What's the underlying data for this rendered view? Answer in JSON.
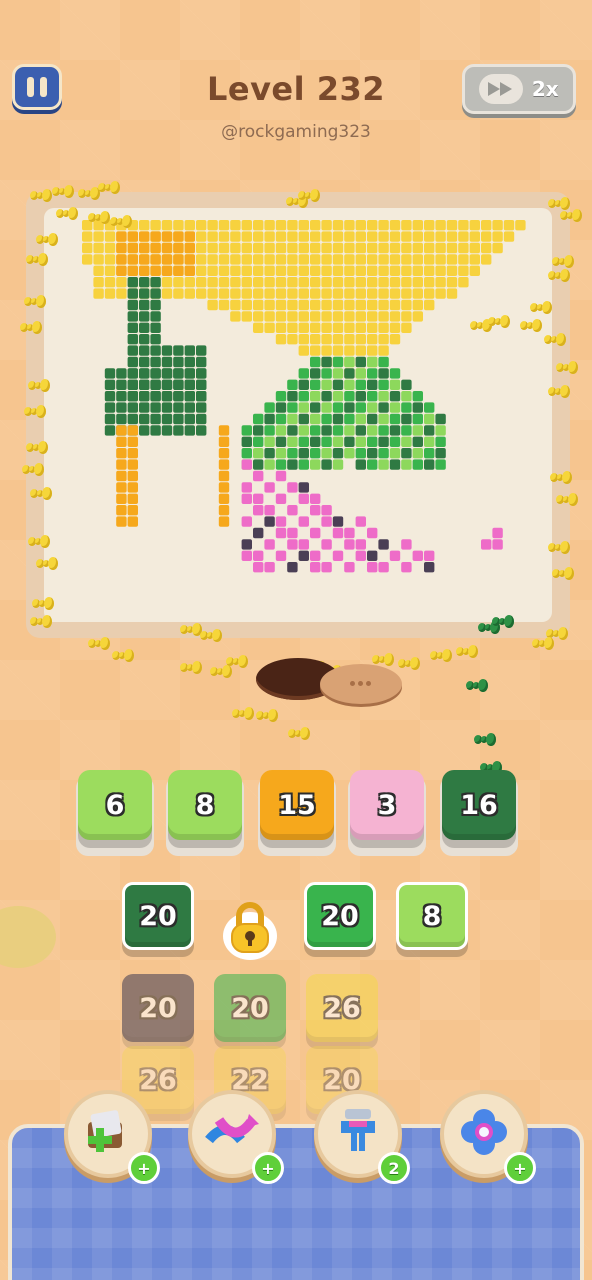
{
  "header": {
    "title": "Level 232",
    "subtitle": "@rockgaming323",
    "speed_label": "2x"
  },
  "queue": [
    {
      "value": "6",
      "color": "#9cdc5e"
    },
    {
      "value": "8",
      "color": "#9cdc5e"
    },
    {
      "value": "15",
      "color": "#f6a81c"
    },
    {
      "value": "3",
      "color": "#f5b3d2"
    },
    {
      "value": "16",
      "color": "#2f7a43"
    }
  ],
  "grid": {
    "row1": [
      {
        "value": "20",
        "color": "#2f7a43"
      },
      {
        "value": "20",
        "color": "#39b44d"
      },
      {
        "value": "8",
        "color": "#9cdc5e"
      }
    ],
    "row2": [
      {
        "value": "20",
        "color": "#3f3b52"
      },
      {
        "value": "20",
        "color": "#39b44d"
      },
      {
        "value": "26",
        "color": "#f5d84a"
      }
    ],
    "row3": [
      {
        "value": "26",
        "color": "#f5d84a"
      },
      {
        "value": "22",
        "color": "#f5d84a"
      },
      {
        "value": "20",
        "color": "#f5d84a"
      }
    ]
  },
  "boosters": [
    {
      "name": "add-box",
      "badge": "+"
    },
    {
      "name": "shuffle",
      "badge": "+"
    },
    {
      "name": "magnet-claw",
      "badge": "2"
    },
    {
      "name": "flower",
      "badge": "+"
    }
  ],
  "colors": {
    "yellow": "#f7d23e",
    "orange": "#f6a81c",
    "dark_green": "#2f7a43",
    "mid_green": "#39b44d",
    "light_green": "#8dd85c",
    "pink": "#ee6cc8",
    "dark": "#4a3f55"
  }
}
